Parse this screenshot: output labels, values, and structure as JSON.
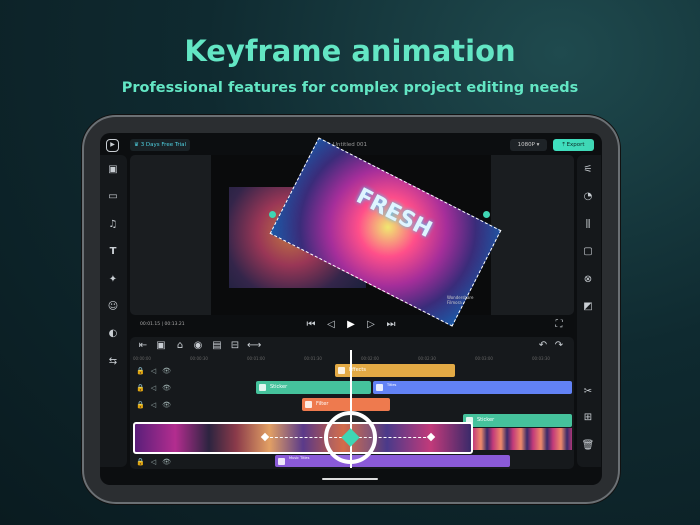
{
  "headline": "Keyframe animation",
  "subheadline": "Professional features for complex project editing needs",
  "topbar": {
    "trial": "3 Days Free Trial",
    "title": "Untitled 001",
    "resolution": "1080P",
    "export": "Export"
  },
  "preview": {
    "watermark_line1": "Wondershare",
    "watermark_line2": "Filmora",
    "neon_text": "FRESH"
  },
  "playback": {
    "current": "00:01.15",
    "total": "00:13.21"
  },
  "ruler": [
    "00:00:00",
    "00:00:30",
    "00:01:00",
    "00:01:30",
    "00:02:00",
    "00:02:30",
    "00:03:00",
    "00:03:30"
  ],
  "clips": {
    "effects": "Effects",
    "sticker1": "Sticker",
    "titles": "Titles",
    "filter": "Filter",
    "sticker2": "Sticker",
    "music": "Music Titles"
  },
  "colors": {
    "accent": "#3fd6b4",
    "effects": "#e3aa45",
    "sticker": "#45c29c",
    "titles": "#6282f5",
    "filter": "#ee7a4e",
    "music": "#8a5ad8"
  }
}
